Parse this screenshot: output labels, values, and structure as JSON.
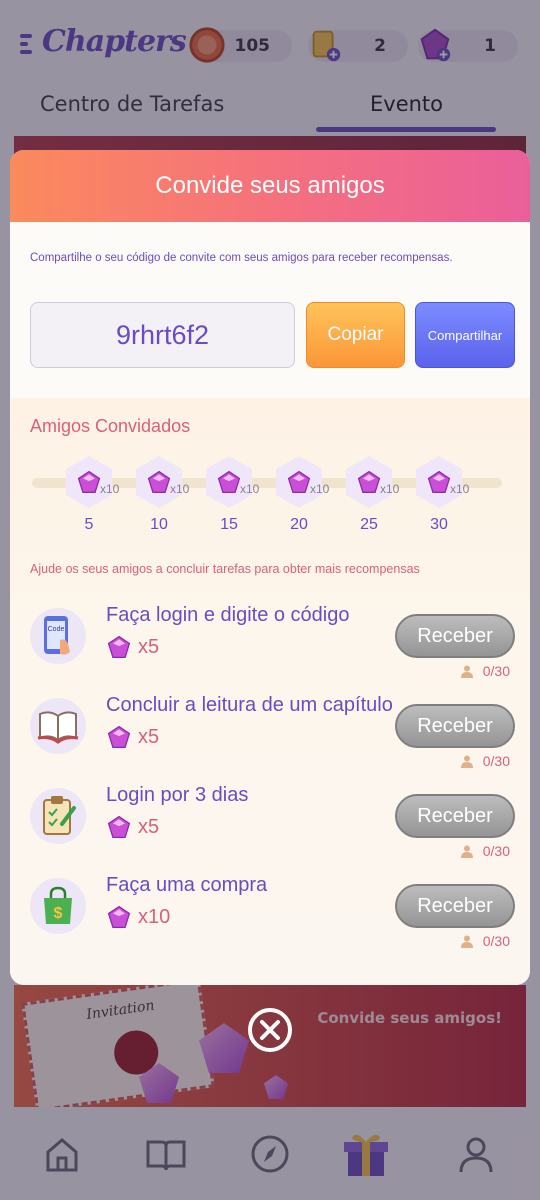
{
  "app": {
    "logo": "Chapters"
  },
  "currencies": [
    {
      "icon": "coin-icon",
      "value": "105"
    },
    {
      "icon": "ticket-icon",
      "value": "2"
    },
    {
      "icon": "gem-icon",
      "value": "1"
    }
  ],
  "tabs": [
    {
      "label": "Centro de Tarefas",
      "active": false
    },
    {
      "label": "Evento",
      "active": true
    }
  ],
  "banner": {
    "caption": "Convide seus amigos!",
    "envelope_text": "Invitation"
  },
  "dialog": {
    "title": "Convide seus amigos",
    "intro": "Compartilhe o seu código de convite com seus amigos para receber recompensas.",
    "invite_code": "9rhrt6f2",
    "copy_label": "Copiar",
    "share_label": "Compartilhar",
    "friends_title": "Amigos Convidados",
    "milestones": [
      {
        "count": "5",
        "reward": "x10"
      },
      {
        "count": "10",
        "reward": "x10"
      },
      {
        "count": "15",
        "reward": "x10"
      },
      {
        "count": "20",
        "reward": "x10"
      },
      {
        "count": "25",
        "reward": "x10"
      },
      {
        "count": "30",
        "reward": "x10"
      }
    ],
    "help_text": "Ajude os seus amigos a concluir tarefas para obter mais recompensas",
    "tasks": [
      {
        "title": "Faça login e digite o código",
        "reward": "x5",
        "button": "Receber",
        "progress": "0/30",
        "icon": "code-phone-icon",
        "icon_text": "Code"
      },
      {
        "title": "Concluir a leitura de um capítulo",
        "reward": "x5",
        "button": "Receber",
        "progress": "0/30",
        "icon": "book-icon"
      },
      {
        "title": "Login por 3 dias",
        "reward": "x5",
        "button": "Receber",
        "progress": "0/30",
        "icon": "clipboard-icon"
      },
      {
        "title": "Faça uma compra",
        "reward": "x10",
        "button": "Receber",
        "progress": "0/30",
        "icon": "shopping-bag-icon"
      }
    ]
  },
  "bottom_nav": [
    {
      "icon": "home-icon"
    },
    {
      "icon": "book-icon"
    },
    {
      "icon": "compass-icon"
    },
    {
      "icon": "gift-icon",
      "active": true
    },
    {
      "icon": "profile-icon"
    }
  ],
  "colors": {
    "accent": "#6a4cc2",
    "pink": "#d8607c",
    "header_start": "#fb8a5c",
    "header_end": "#ea5f9a"
  }
}
